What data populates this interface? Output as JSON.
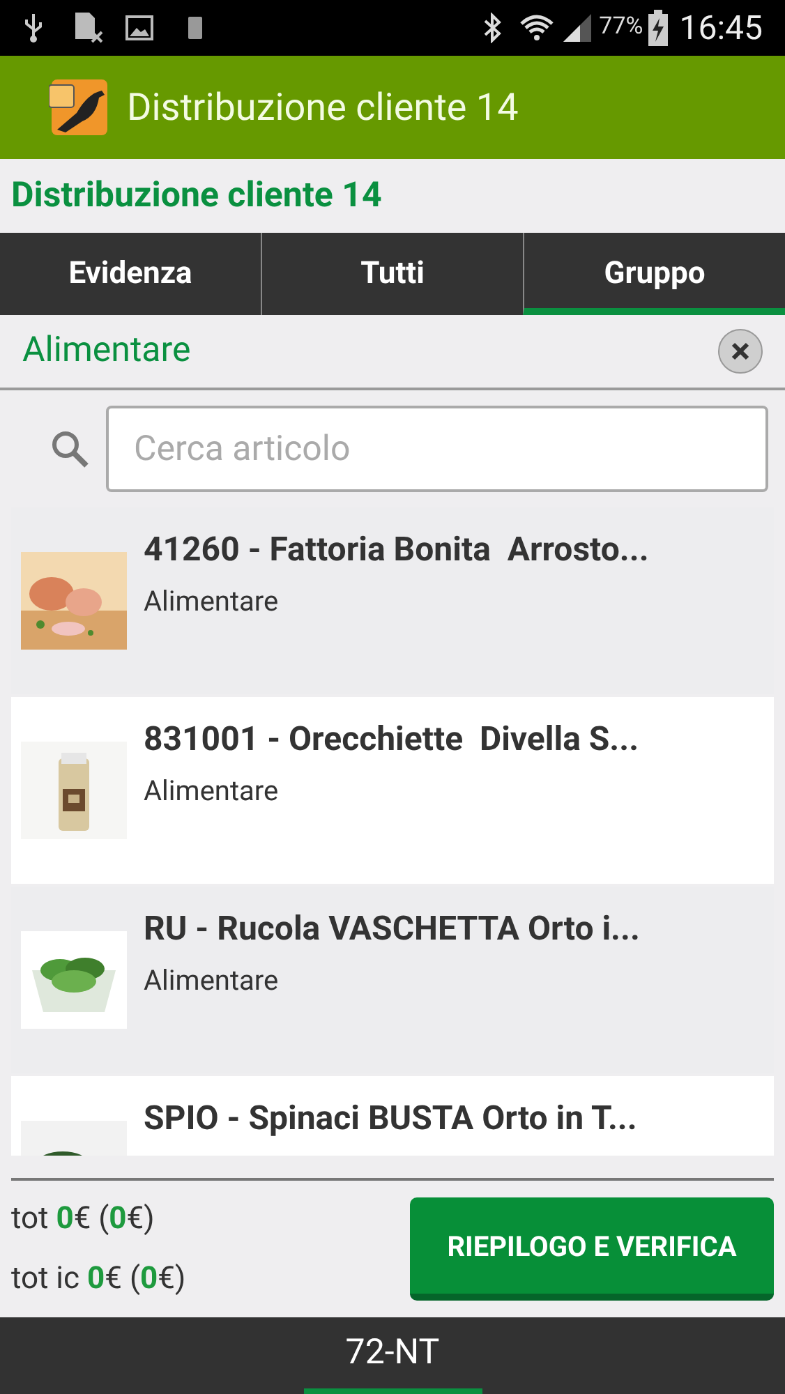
{
  "status_bar": {
    "battery_percent": "77%",
    "time": "16:45"
  },
  "app_bar": {
    "title": "Distribuzione cliente 14"
  },
  "page_title": "Distribuzione cliente 14",
  "tabs": [
    {
      "label": "Evidenza",
      "selected": false
    },
    {
      "label": "Tutti",
      "selected": false
    },
    {
      "label": "Gruppo",
      "selected": true
    }
  ],
  "group_filter": {
    "label": "Alimentare"
  },
  "search": {
    "placeholder": "Cerca articolo"
  },
  "items": [
    {
      "title": "41260 - Fattoria Bonita  Arrosto...",
      "category": "Alimentare"
    },
    {
      "title": "831001 - Orecchiette  Divella S...",
      "category": "Alimentare"
    },
    {
      "title": "RU - Rucola VASCHETTA Orto i...",
      "category": "Alimentare"
    },
    {
      "title": "SPIO - Spinaci BUSTA Orto in T..."
    }
  ],
  "totals": [
    "tot **0**€ (**0**€)",
    "tot ic **0**€ (**0**€)"
  ],
  "action_button": "RIEPILOGO E VERIFICA",
  "bottom_tab": {
    "label": "72-NT",
    "selected": true
  }
}
